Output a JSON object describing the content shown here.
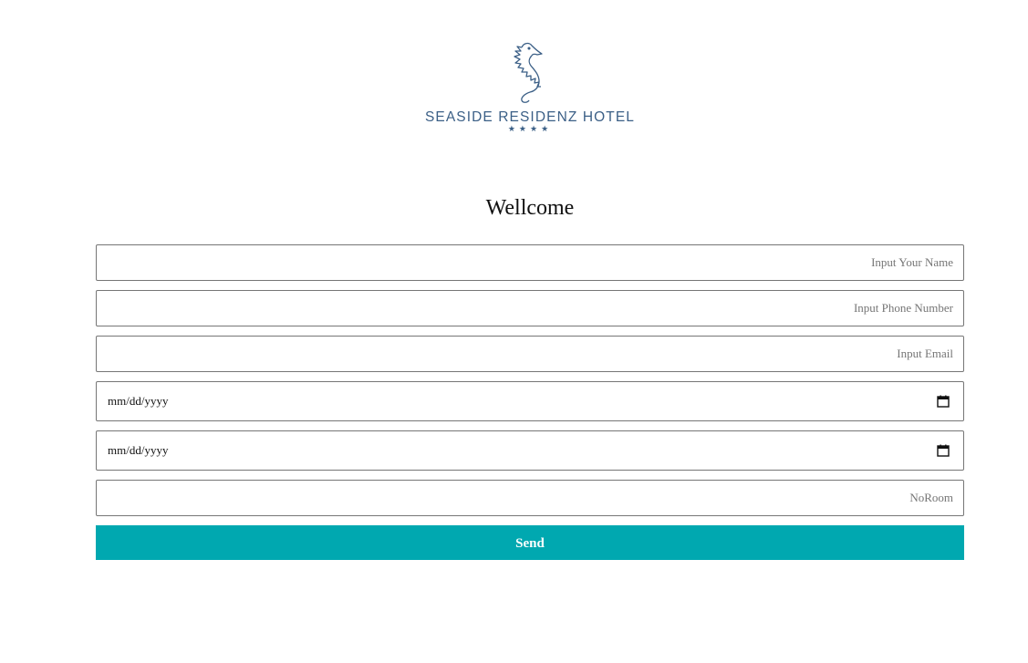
{
  "logo": {
    "brand_name": "SEASIDE RESIDENZ HOTEL",
    "stars": "★★★★",
    "color": "#3b5f86",
    "emblem": "seahorse-icon"
  },
  "page": {
    "heading": "Wellcome"
  },
  "form": {
    "name_placeholder": "Input Your Name",
    "phone_placeholder": "Input Phone Number",
    "email_placeholder": "Input Email",
    "checkin_value": "mm/dd/yyyy",
    "checkout_value": "mm/dd/yyyy",
    "room_placeholder": "NoRoom",
    "send_label": "Send"
  },
  "colors": {
    "button": "#00a8b0",
    "border": "#767676"
  }
}
